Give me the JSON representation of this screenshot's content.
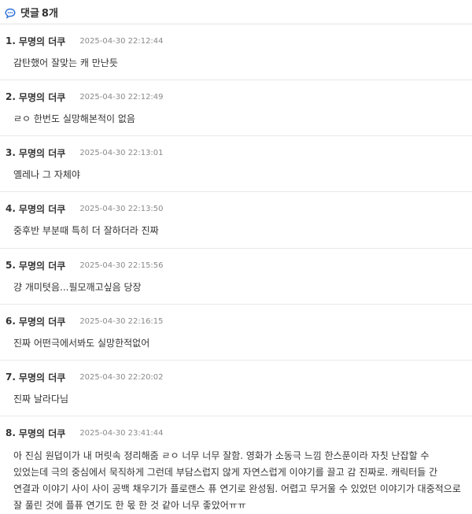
{
  "header": {
    "title": "댓글",
    "count": "8개"
  },
  "comments": [
    {
      "num": "1.",
      "author": "무명의 더쿠",
      "time": "2025-04-30 22:12:44",
      "text": "감탄했어 잘맞는 캐 만난듯"
    },
    {
      "num": "2.",
      "author": "무명의 더쿠",
      "time": "2025-04-30 22:12:49",
      "text": "ㄹㅇ 한번도 실망해본적이 없음"
    },
    {
      "num": "3.",
      "author": "무명의 더쿠",
      "time": "2025-04-30 22:13:01",
      "text": "옐레나 그 자체야"
    },
    {
      "num": "4.",
      "author": "무명의 더쿠",
      "time": "2025-04-30 22:13:50",
      "text": "중후반 부분때 특히 더 잘하더라 진짜"
    },
    {
      "num": "5.",
      "author": "무명의 더쿠",
      "time": "2025-04-30 22:15:56",
      "text": "걍 개미텻음...필모깨고싶음 당장"
    },
    {
      "num": "6.",
      "author": "무명의 더쿠",
      "time": "2025-04-30 22:16:15",
      "text": "진짜 어떤극에서봐도 실망한적없어"
    },
    {
      "num": "7.",
      "author": "무명의 더쿠",
      "time": "2025-04-30 22:20:02",
      "text": "진짜 날라다님"
    },
    {
      "num": "8.",
      "author": "무명의 더쿠",
      "time": "2025-04-30 23:41:44",
      "text": "아 진심 원덥이가 내 머릿속 정리해줌 ㄹㅇ 너무 너무 잘함. 영화가 소동극 느낌 한스푼이라 자칫 난잡할 수 있었는데 극의 중심에서 묵직하게 그런데 부담스럽지 않게 자연스럽게 이야기를 끌고 감 진짜로. 캐릭터들 간 연결과 이야기 사이 사이 공백 채우기가 플로랜스 퓨 연기로 완성됨. 어렵고 무거울 수 있었던 이야기가 대중적으로 잘 풀린 것에 플퓨 연기도 한 몫 한 것 같아 너무 좋았어ㅠㅠ"
    }
  ]
}
